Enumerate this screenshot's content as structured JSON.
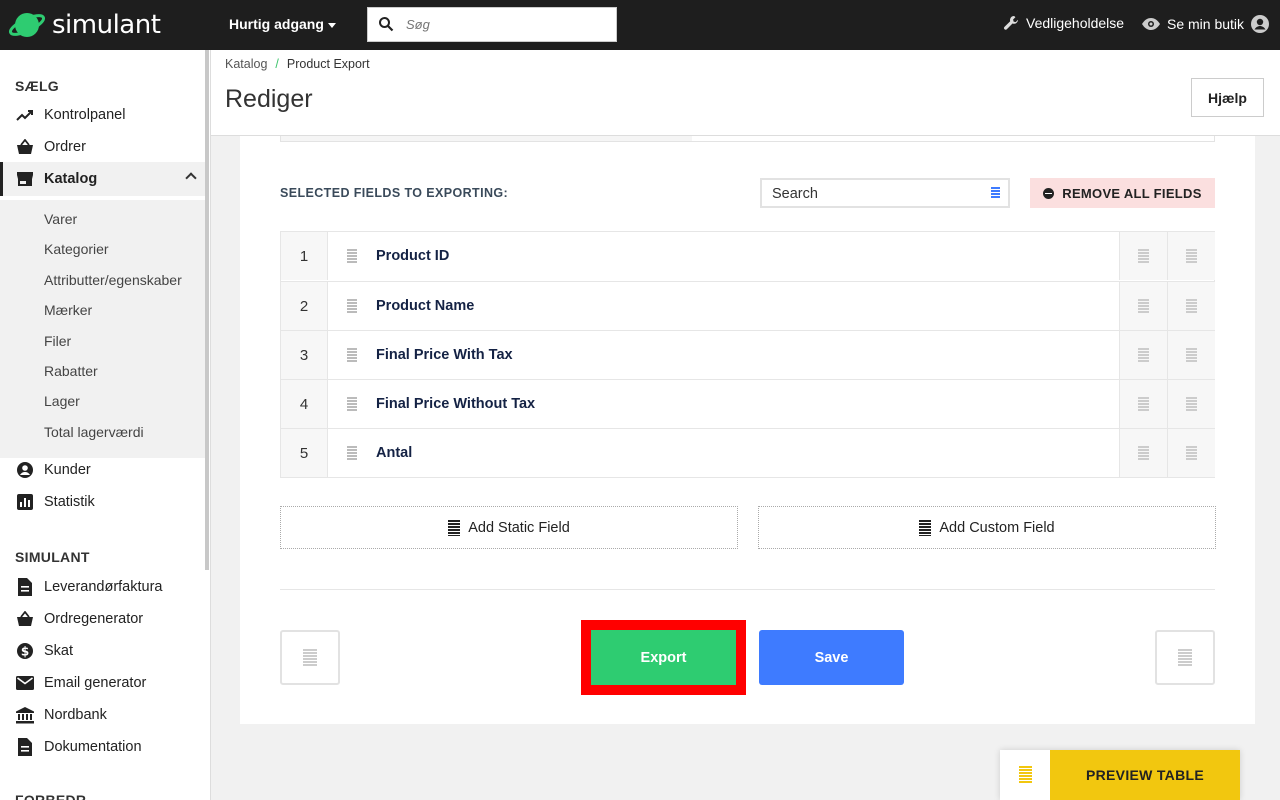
{
  "topbar": {
    "brand": "simulant",
    "quick_access": "Hurtig adgang",
    "search_placeholder": "Søg",
    "maintenance": "Vedligeholdelse",
    "view_store": "Se min butik"
  },
  "sidebar": {
    "section_sell": "SÆLG",
    "items_top": [
      {
        "label": "Kontrolpanel",
        "icon": "trend-icon"
      },
      {
        "label": "Ordrer",
        "icon": "basket-icon"
      },
      {
        "label": "Katalog",
        "icon": "store-icon"
      }
    ],
    "catalog_sub": [
      "Varer",
      "Kategorier",
      "Attributter/egenskaber",
      "Mærker",
      "Filer",
      "Rabatter",
      "Lager",
      "Total lagerværdi"
    ],
    "items_after": [
      {
        "label": "Kunder",
        "icon": "user-circle-icon"
      },
      {
        "label": "Statistik",
        "icon": "bar-chart-icon"
      }
    ],
    "section_simulant": "SIMULANT",
    "items_simulant": [
      {
        "label": "Leverandørfaktura",
        "icon": "document-icon"
      },
      {
        "label": "Ordregenerator",
        "icon": "basket-icon"
      },
      {
        "label": "Skat",
        "icon": "dollar-icon"
      },
      {
        "label": "Email generator",
        "icon": "mail-icon"
      },
      {
        "label": "Nordbank",
        "icon": "bank-icon"
      },
      {
        "label": "Dokumentation",
        "icon": "document-icon"
      }
    ],
    "section_cut": "FORBEDR"
  },
  "header": {
    "breadcrumb_root": "Katalog",
    "breadcrumb_sep": "/",
    "breadcrumb_current": "Product Export",
    "title": "Rediger",
    "help": "Hjælp"
  },
  "main": {
    "selected_label": "SELECTED FIELDS TO EXPORTING:",
    "search_placeholder": "Search",
    "remove_all": "REMOVE ALL FIELDS",
    "fields": [
      {
        "num": "1",
        "name": "Product ID"
      },
      {
        "num": "2",
        "name": "Product Name"
      },
      {
        "num": "3",
        "name": "Final Price With Tax"
      },
      {
        "num": "4",
        "name": "Final Price Without Tax"
      },
      {
        "num": "5",
        "name": "Antal"
      }
    ],
    "add_static": "Add Static Field",
    "add_custom": "Add Custom Field",
    "export": "Export",
    "save": "Save",
    "preview_table": "PREVIEW TABLE"
  },
  "colors": {
    "export": "#2ecc71",
    "save": "#3e7bff",
    "preview": "#f2c70f",
    "remove_bg": "#fbdfdf",
    "highlight": "#ff0000"
  }
}
